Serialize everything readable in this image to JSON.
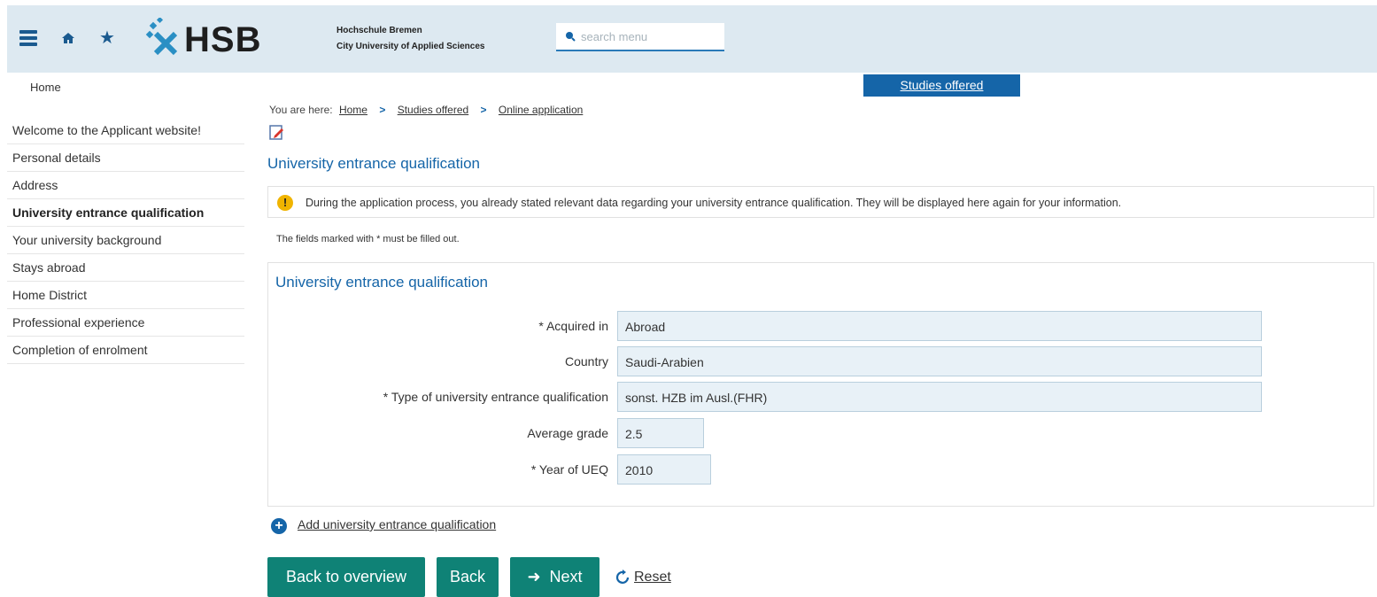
{
  "header": {
    "logo_text": "HSB",
    "school_line1": "Hochschule Bremen",
    "school_line2": "City University of Applied Sciences",
    "search_placeholder": "search menu"
  },
  "nav": {
    "home": "Home",
    "studies_tab": "Studies offered"
  },
  "sidebar": {
    "items": [
      {
        "label": "Welcome to the Applicant website!"
      },
      {
        "label": "Personal details"
      },
      {
        "label": "Address"
      },
      {
        "label": "University entrance qualification"
      },
      {
        "label": "Your university background"
      },
      {
        "label": "Stays abroad"
      },
      {
        "label": "Home District"
      },
      {
        "label": "Professional experience"
      },
      {
        "label": "Completion of enrolment"
      }
    ],
    "active_index": 3
  },
  "breadcrumb": {
    "prefix": "You are here:",
    "items": [
      "Home",
      "Studies offered",
      "Online application"
    ]
  },
  "main": {
    "title": "University entrance qualification",
    "info_text": "During the application process, you already stated relevant data regarding your university entrance qualification. They will be displayed here again for your information.",
    "required_note": "The fields marked with * must be filled out.",
    "panel_title": "University entrance qualification",
    "fields": [
      {
        "label": "* Acquired in",
        "value": "Abroad"
      },
      {
        "label": "Country",
        "value": "Saudi-Arabien"
      },
      {
        "label": "* Type of university entrance qualification",
        "value": "sonst. HZB im Ausl.(FHR)"
      },
      {
        "label": "Average grade",
        "value": "2.5"
      },
      {
        "label": "* Year of UEQ",
        "value": "2010"
      }
    ],
    "add_link": "Add university entrance qualification"
  },
  "buttons": {
    "overview": "Back to overview",
    "back": "Back",
    "next": "Next",
    "reset": "Reset"
  },
  "colors": {
    "header_bg": "#dde9f1",
    "accent_blue": "#1565a8",
    "button_teal": "#0f8276",
    "info_yellow": "#f0b400"
  },
  "icons": [
    "menu-icon",
    "home-icon",
    "star-icon",
    "hsb-logo-icon",
    "search-icon",
    "edit-icon",
    "info-icon",
    "add-icon",
    "arrow-right-icon",
    "reset-icon",
    "chevron-right-icon"
  ]
}
